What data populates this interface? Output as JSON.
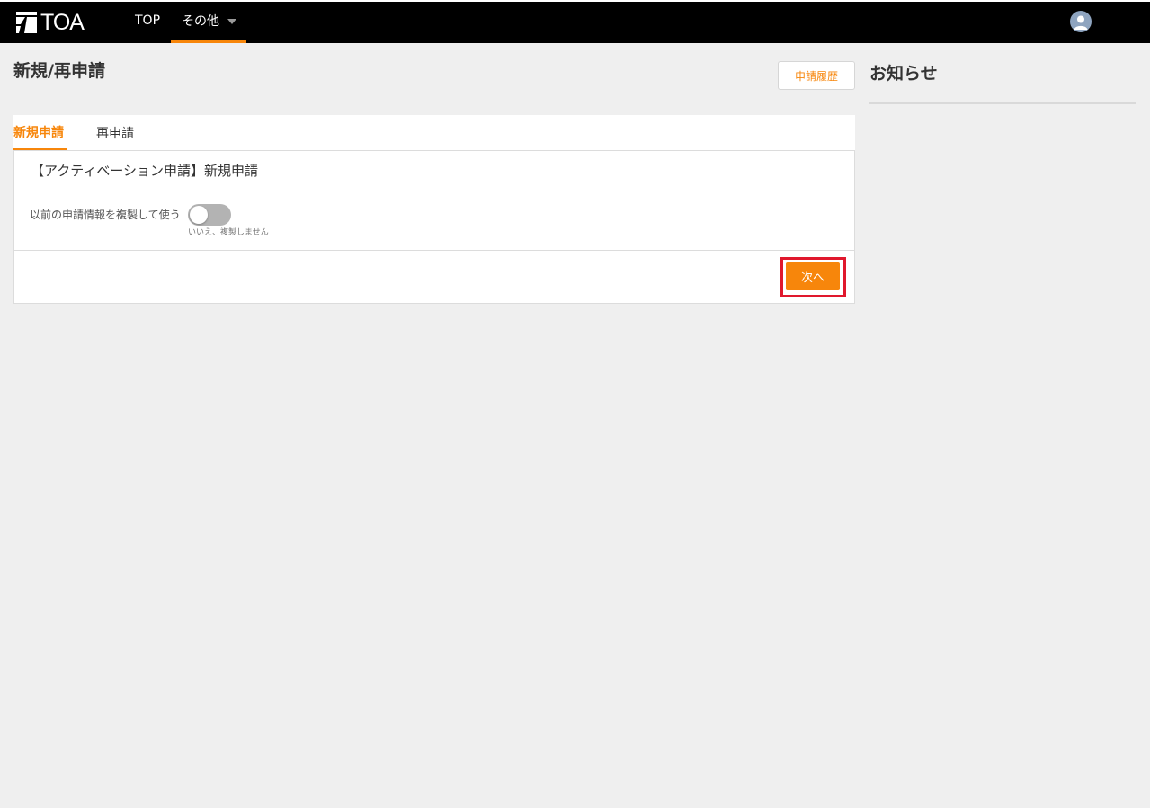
{
  "header": {
    "logo_text": "TOA",
    "nav": {
      "top_label": "TOP",
      "other_label": "その他"
    }
  },
  "main": {
    "title": "新規/再申請",
    "history_button": "申請履歴",
    "tabs": [
      {
        "label": "新規申請",
        "active": true
      },
      {
        "label": "再申請",
        "active": false
      }
    ],
    "card": {
      "title": "【アクティベーション申請】新規申請",
      "copy_label": "以前の申請情報を複製して使う",
      "copy_toggle_on": false,
      "copy_state_text": "いいえ、複製しません",
      "next_button": "次へ"
    }
  },
  "sidebar": {
    "notice_title": "お知らせ"
  },
  "colors": {
    "accent": "#f7860b",
    "header_bg": "#000000",
    "page_bg": "#efefef",
    "highlight": "#e0182d"
  }
}
